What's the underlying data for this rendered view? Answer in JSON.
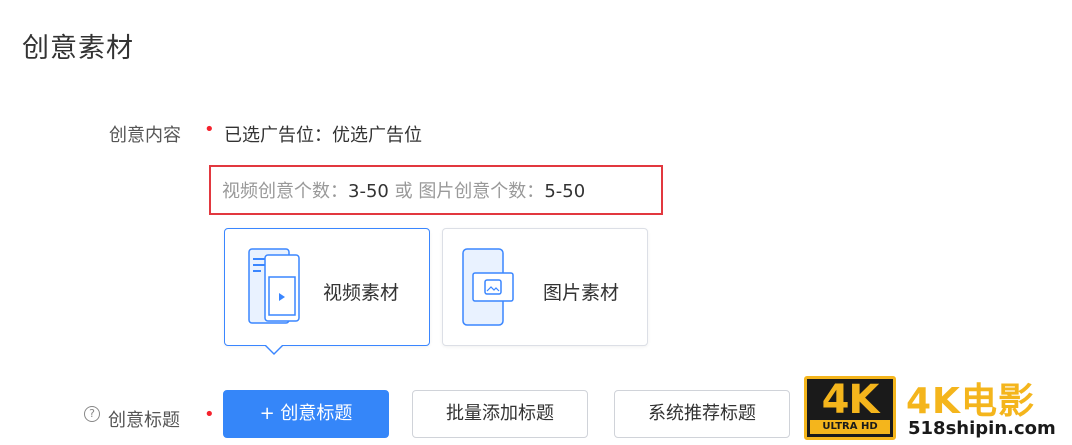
{
  "page_title": "创意素材",
  "content_row": {
    "label": "创意内容",
    "required_mark": "•",
    "selected_placement": "已选广告位：优选广告位"
  },
  "hint": {
    "video_label": "视频创意个数：",
    "video_range": "3-50",
    "or": " 或 ",
    "image_label": "图片创意个数：",
    "image_range": "5-50"
  },
  "cards": [
    {
      "label": "视频素材",
      "icon": "video-material-icon",
      "selected": true
    },
    {
      "label": "图片素材",
      "icon": "image-material-icon",
      "selected": false
    }
  ],
  "title_row": {
    "help_icon": "?",
    "label": "创意标题",
    "required_mark": "•",
    "buttons": {
      "add": "+ 创意标题",
      "batch": "批量添加标题",
      "recommend": "系统推荐标题"
    }
  },
  "watermark": {
    "badge": "4K",
    "badge_sub": "ULTRA HD",
    "title": "4K电影",
    "site": "518shipin.com"
  },
  "colors": {
    "primary": "#3586f9",
    "required": "#f5222d",
    "highlight_box": "#e2383f",
    "watermark_gold": "#f4b51c"
  }
}
